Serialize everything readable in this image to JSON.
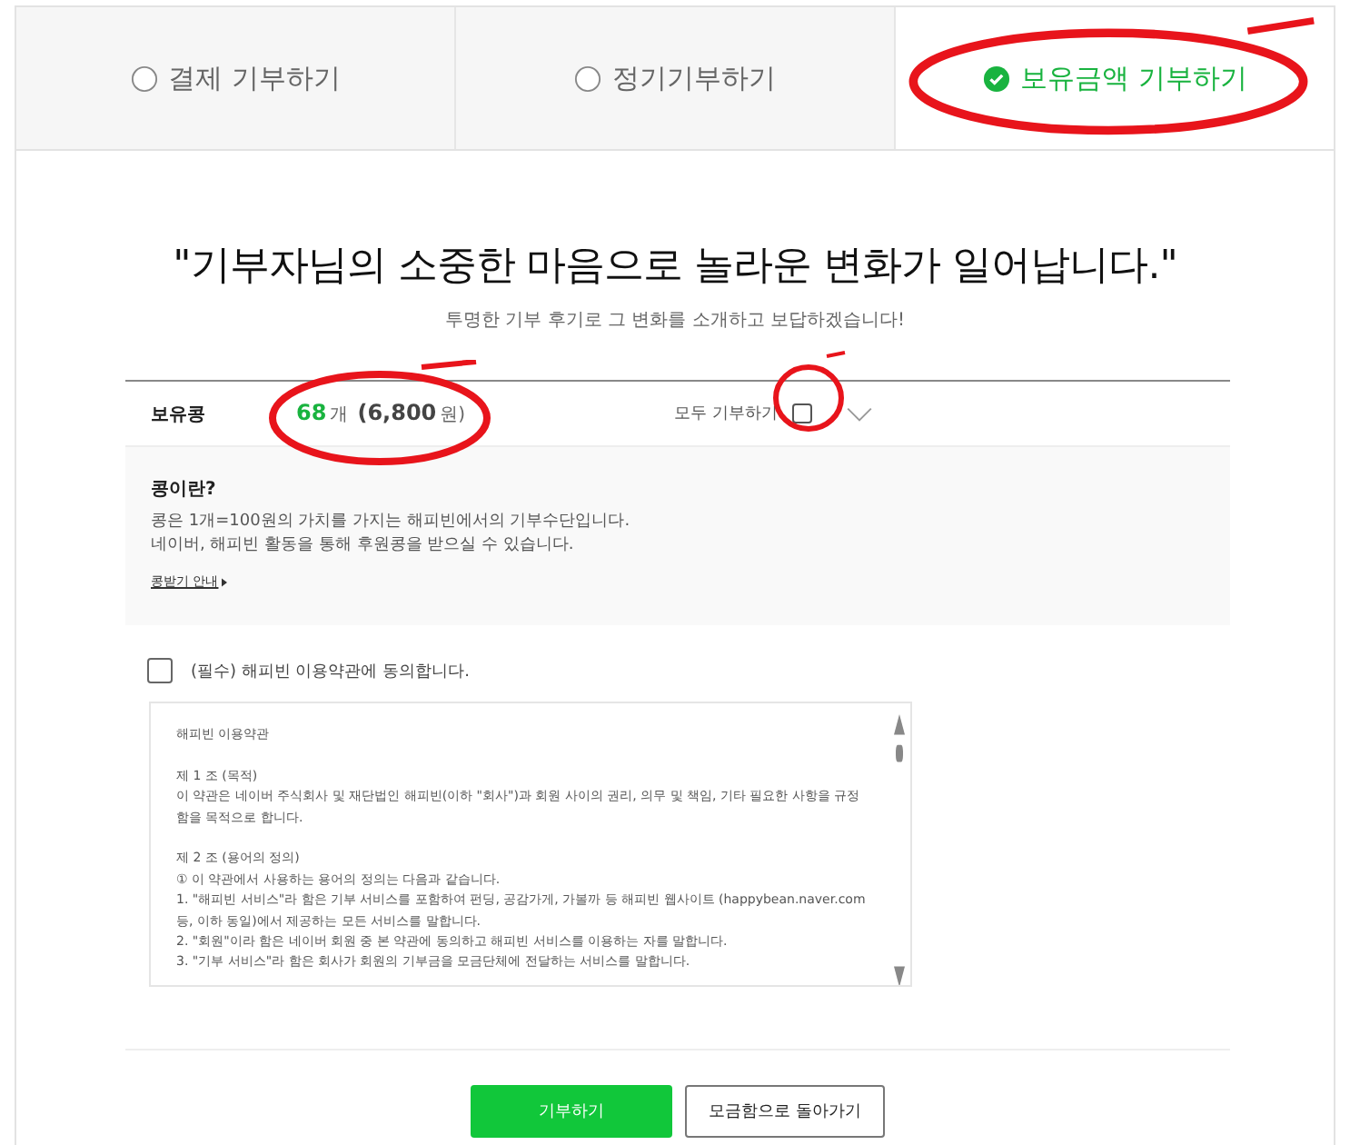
{
  "tabs": [
    {
      "label": "결제 기부하기",
      "selected": false,
      "marked": false
    },
    {
      "label": "정기기부하기",
      "selected": false,
      "marked": false
    },
    {
      "label": "보유금액 기부하기",
      "selected": true,
      "marked": true
    }
  ],
  "headline": "\"기부자님의 소중한 마음으로 놀라운 변화가 일어납니다.\"",
  "subtitle": "투명한 기부 후기로 그 변화를 소개하고 보답하겠습니다!",
  "bean_row": {
    "label": "보유콩",
    "count": "68",
    "unit": "개",
    "amount": "(6,800",
    "amount_unit": "원)",
    "amount_marked": true,
    "all_label": "모두 기부하기",
    "all_checked": false,
    "all_marked": true
  },
  "info": {
    "title": "콩이란?",
    "lines": [
      "콩은 1개=100원의 가치를 가지는 해피빈에서의 기부수단입니다.",
      "네이버, 해피빈 활동을 통해 후원콩을 받으실 수 있습니다."
    ],
    "link": "콩받기 안내"
  },
  "agree": {
    "label": "(필수) 해피빈 이용약관에 동의합니다.",
    "checked": false
  },
  "terms": [
    {
      "lines": [
        "해피빈 이용약관"
      ]
    },
    {
      "lines": [
        "제 1 조 (목적)",
        "이 약관은 네이버 주식회사 및 재단법인 해피빈(이하 \"회사\")과 회원 사이의 권리, 의무 및 책임, 기타 필요한 사항을 규정함을 목적으로 합니다."
      ]
    },
    {
      "lines": [
        "제 2 조 (용어의 정의)",
        "① 이 약관에서 사용하는 용어의 정의는 다음과 같습니다.",
        "1. \"해피빈 서비스\"라 함은 기부 서비스를 포함하여 펀딩, 공감가게, 가볼까 등 해피빈 웹사이트 (happybean.naver.com 등, 이하 동일)에서 제공하는 모든 서비스를 말합니다.",
        "2. \"회원\"이라 함은 네이버 회원 중 본 약관에 동의하고 해피빈 서비스를 이용하는 자를 말합니다.",
        "3. \"기부 서비스\"라 함은 회사가 회원의 기부금을 모금단체에 전달하는 서비스를 말합니다."
      ]
    }
  ],
  "buttons": [
    {
      "label": "기부하기",
      "kind": "primary"
    },
    {
      "label": "모금함으로 돌아가기",
      "kind": "secondary"
    }
  ]
}
